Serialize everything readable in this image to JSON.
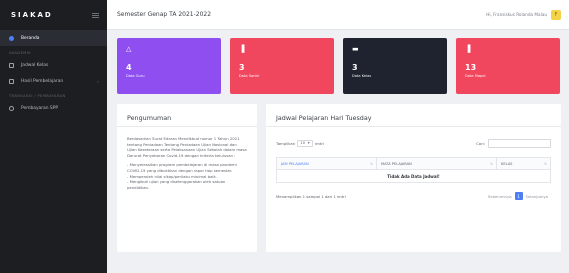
{
  "sidebar": {
    "brand": "SIAKAD",
    "items": [
      {
        "label": "Beranda",
        "active": true
      },
      {
        "section": "AKADEMIK"
      },
      {
        "label": "Jadwal Kelas"
      },
      {
        "label": "Hasil Pembelajaran",
        "has_submenu": true
      },
      {
        "section": "TRANSAKSI / PEMBAYARAN"
      },
      {
        "label": "Pembayaran SPP"
      }
    ]
  },
  "topbar": {
    "semester": "Semester Genap TA 2021-2022",
    "user_name": "Hi, Fransiskus Rolanda Malau",
    "avatar_letter": "F"
  },
  "cards": [
    {
      "value": "4",
      "label": "Data Guru",
      "color": "#8e4ef0",
      "icon": "users-icon",
      "glyph": "△"
    },
    {
      "value": "3",
      "label": "Data Santri",
      "color": "#f0475f",
      "icon": "chart-icon",
      "glyph": "▐"
    },
    {
      "value": "3",
      "label": "Data Kelas",
      "color": "#1f2330",
      "icon": "monitor-icon",
      "glyph": "▬"
    },
    {
      "value": "13",
      "label": "Data Mapel",
      "color": "#f0475f",
      "icon": "chart-icon",
      "glyph": "▐"
    }
  ],
  "announcement": {
    "title": "Pengumuman",
    "paragraphs": [
      "Berdasarkan Surat Edaran Mendikbud nomor 1 Tahun 2021 tentang Peniadaan Tentang Peniadaan Ujian Nasional dan Ujian Kesetaraan serta Pelaksanaan Ujian Sekolah dalam masa Darurat Penyebaran Covid-19 dengan kriteria kelulusan :",
      "- Menyelesaikan program pembelajaran di masa pandemi COVID-19 yang dibuktikan dengan rapor tiap semester.\n- Memperoleh nilai sikap/perilaku minimal baik.\n- Mengikuti ujian yang diselenggarakan oleh satuan pendidikan."
    ]
  },
  "schedule": {
    "title": "Jadwal Pelajaran Hari Tuesday",
    "length_prefix": "Tampilkan",
    "length_value": "10",
    "length_suffix": "entri",
    "search_label": "Cari:",
    "columns": [
      "JAM PELAJARAN",
      "MATA PELAJARAN",
      "KELAS"
    ],
    "empty_text": "Tidak Ada Data Jadwal!",
    "info": "Menampilkan 1 sampai 1 dari 1 entri",
    "prev_label": "Sebelumnya",
    "page": "1",
    "next_label": "Selanjutnya"
  },
  "colors": {
    "accent": "#4e7ef5",
    "sidebar_bg": "#1c1e22"
  }
}
